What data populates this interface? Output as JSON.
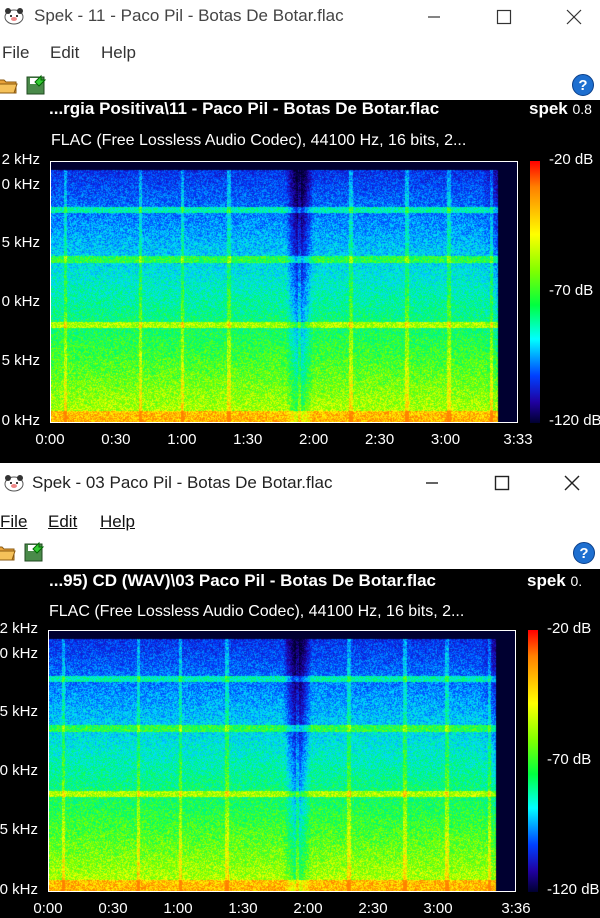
{
  "windows": [
    {
      "title": "Spek - 11 - Paco Pil - Botas De Botar.flac",
      "menu": {
        "file": "File",
        "edit": "Edit",
        "help": "Help"
      },
      "file_title": "...rgia Positiva\\11 - Paco Pil - Botas De Botar.flac",
      "spek_label": "spek",
      "spek_version": "0.8",
      "info": "FLAC (Free Lossless Audio Codec), 44100 Hz, 16 bits, 2...",
      "y_ticks": [
        "2 kHz",
        "0 kHz",
        "5 kHz",
        "0 kHz",
        "5 kHz",
        "0 kHz"
      ],
      "x_ticks": [
        "0:00",
        "0:30",
        "1:00",
        "1:30",
        "2:00",
        "2:30",
        "3:00",
        "3:33"
      ],
      "colorbar": [
        "-20 dB",
        "-70 dB",
        "-120 dB"
      ],
      "duration_s": 213
    },
    {
      "title": "Spek - 03 Paco Pil - Botas De Botar.flac",
      "menu": {
        "file": "File",
        "edit": "Edit",
        "help": "Help"
      },
      "file_title": "...95) CD (WAV)\\03 Paco Pil - Botas De Botar.flac",
      "spek_label": "spek",
      "spek_version": "0.",
      "info": "FLAC (Free Lossless Audio Codec), 44100 Hz, 16 bits, 2...",
      "y_ticks": [
        "2 kHz",
        "0 kHz",
        "5 kHz",
        "0 kHz",
        "5 kHz",
        "0 kHz"
      ],
      "x_ticks": [
        "0:00",
        "0:30",
        "1:00",
        "1:30",
        "2:00",
        "2:30",
        "3:00",
        "3:36"
      ],
      "colorbar": [
        "-20 dB",
        "-70 dB",
        "-120 dB"
      ],
      "duration_s": 216
    }
  ],
  "icons": {
    "app": "spek-icon",
    "open": "folder-open-icon",
    "save": "save-icon",
    "help": "help-icon"
  },
  "colors": {
    "background": "#000000",
    "text": "#ffffff",
    "chrome": "#ffffff",
    "help_blue": "#1e6fd0"
  }
}
